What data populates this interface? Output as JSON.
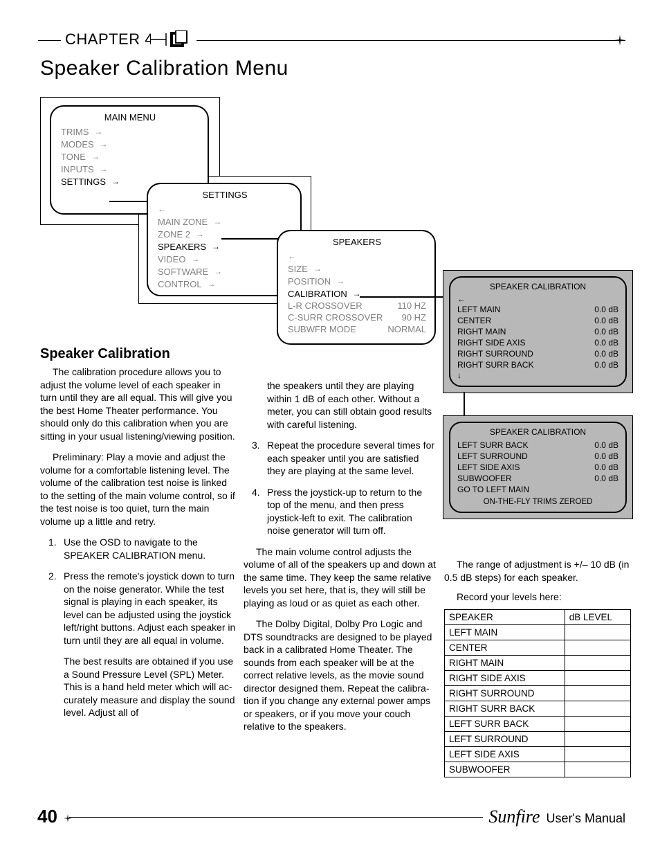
{
  "header": {
    "chapter": "CHAPTER 4"
  },
  "title": "Speaker Calibration Menu",
  "mainMenu": {
    "title": "MAIN MENU",
    "items": [
      "TRIMS",
      "MODES",
      "TONE",
      "INPUTS",
      "SETTINGS"
    ],
    "selected": "SETTINGS"
  },
  "settingsMenu": {
    "title": "SETTINGS",
    "items": [
      "MAIN ZONE",
      "ZONE 2",
      "SPEAKERS",
      "VIDEO",
      "SOFTWARE",
      "CONTROL"
    ],
    "selected": "SPEAKERS"
  },
  "speakersMenu": {
    "title": "SPEAKERS",
    "items": [
      {
        "label": "SIZE",
        "value": ""
      },
      {
        "label": "POSITION",
        "value": ""
      },
      {
        "label": "CALIBRATION",
        "value": "",
        "selected": true
      },
      {
        "label": "L-R CROSSOVER",
        "value": "110 HZ"
      },
      {
        "label": "C-SURR CROSSOVER",
        "value": "90 HZ"
      },
      {
        "label": "SUBWFR MODE",
        "value": "NORMAL"
      }
    ]
  },
  "calibration1": {
    "title": "SPEAKER CALIBRATION",
    "rows": [
      {
        "label": "LEFT MAIN",
        "value": "0.0 dB"
      },
      {
        "label": "CENTER",
        "value": "0.0 dB"
      },
      {
        "label": "RIGHT MAIN",
        "value": "0.0 dB"
      },
      {
        "label": "RIGHT SIDE AXIS",
        "value": "0.0 dB"
      },
      {
        "label": "RIGHT SURROUND",
        "value": "0.0 dB"
      },
      {
        "label": "RIGHT SURR BACK",
        "value": "0.0 dB"
      }
    ]
  },
  "calibration2": {
    "title": "SPEAKER CALIBRATION",
    "rows": [
      {
        "label": "LEFT SURR BACK",
        "value": "0.0 dB"
      },
      {
        "label": "LEFT SURROUND",
        "value": "0.0 dB"
      },
      {
        "label": "LEFT SIDE AXIS",
        "value": "0.0 dB"
      },
      {
        "label": "SUBWOOFER",
        "value": "0.0 dB"
      },
      {
        "label": "GO TO LEFT MAIN",
        "value": ""
      }
    ],
    "footer": "ON-THE-FLY TRIMS ZEROED"
  },
  "subhead": "Speaker Calibration",
  "body": {
    "p1": "The calibration procedure allows you to adjust the volume level of each speaker in turn until they are all equal. This will give you the best Home The­ater performance. You should only do this calibration when you are sitting in your usual listening/viewing position.",
    "p2": "Preliminary: Play a movie and adjust the volume for a comfortable listening level. The volume of the calibration test noise is linked to the setting of the main volume control, so if the test noise is too quiet, turn the main volume up a little and retry.",
    "li1": "Use the OSD to navigate to the SPEAKER CALIBRATION menu.",
    "li2": "Press the remote's joystick down to turn on the noise generator. While the test signal is playing in each speaker, its level can be adjusted using the joystick left/right buttons. Ad­just each speaker in turn until they are all equal in volume.",
    "li2b": "The best results are obtained if you use a Sound Pressure Level (SPL) Meter. This is a hand held meter which will ac­curately measure and display the sound level. Adjust all of",
    "p3": "the speakers until they are playing within 1 dB of each other. Without a meter, you can still obtain good results with careful listening.",
    "li3": "Repeat the procedure several times for each speaker until you are satisfied they are play­ing at the same level.",
    "li4": "Press the joystick-up to return to the top of the menu, and then press joystick-left to exit. The calibration noise generator will turn off.",
    "p4": "The main volume control adjusts the volume of all of the speakers up and down at the same time. They keep the same relative levels you set here, that is, they will still be playing as loud or as quiet as each other.",
    "p5": "The Dolby Digital, Dolby Pro Logic and DTS soundtracks are designed to be played back in a calibrated Home Theater. The sounds from each speaker will be at the correct relative levels, as the movie sound director designed them. Repeat the calibra­tion if you change any external power amps or speakers, or if you move your couch relative to the speakers."
  },
  "range": "The range of adjustment is +/– 10 dB (in 0.5 dB steps) for each speaker.",
  "record": "Record your levels here:",
  "table": {
    "h1": "SPEAKER",
    "h2": "dB LEVEL",
    "rows": [
      "LEFT MAIN",
      "CENTER",
      "RIGHT MAIN",
      "RIGHT SIDE AXIS",
      "RIGHT SURROUND",
      "RIGHT SURR BACK",
      "LEFT SURR BACK",
      "LEFT SURROUND",
      "LEFT SIDE AXIS",
      "SUBWOOFER"
    ]
  },
  "footer": {
    "pageNum": "40",
    "brand": "Sunfire",
    "manual": "User's Manual"
  }
}
